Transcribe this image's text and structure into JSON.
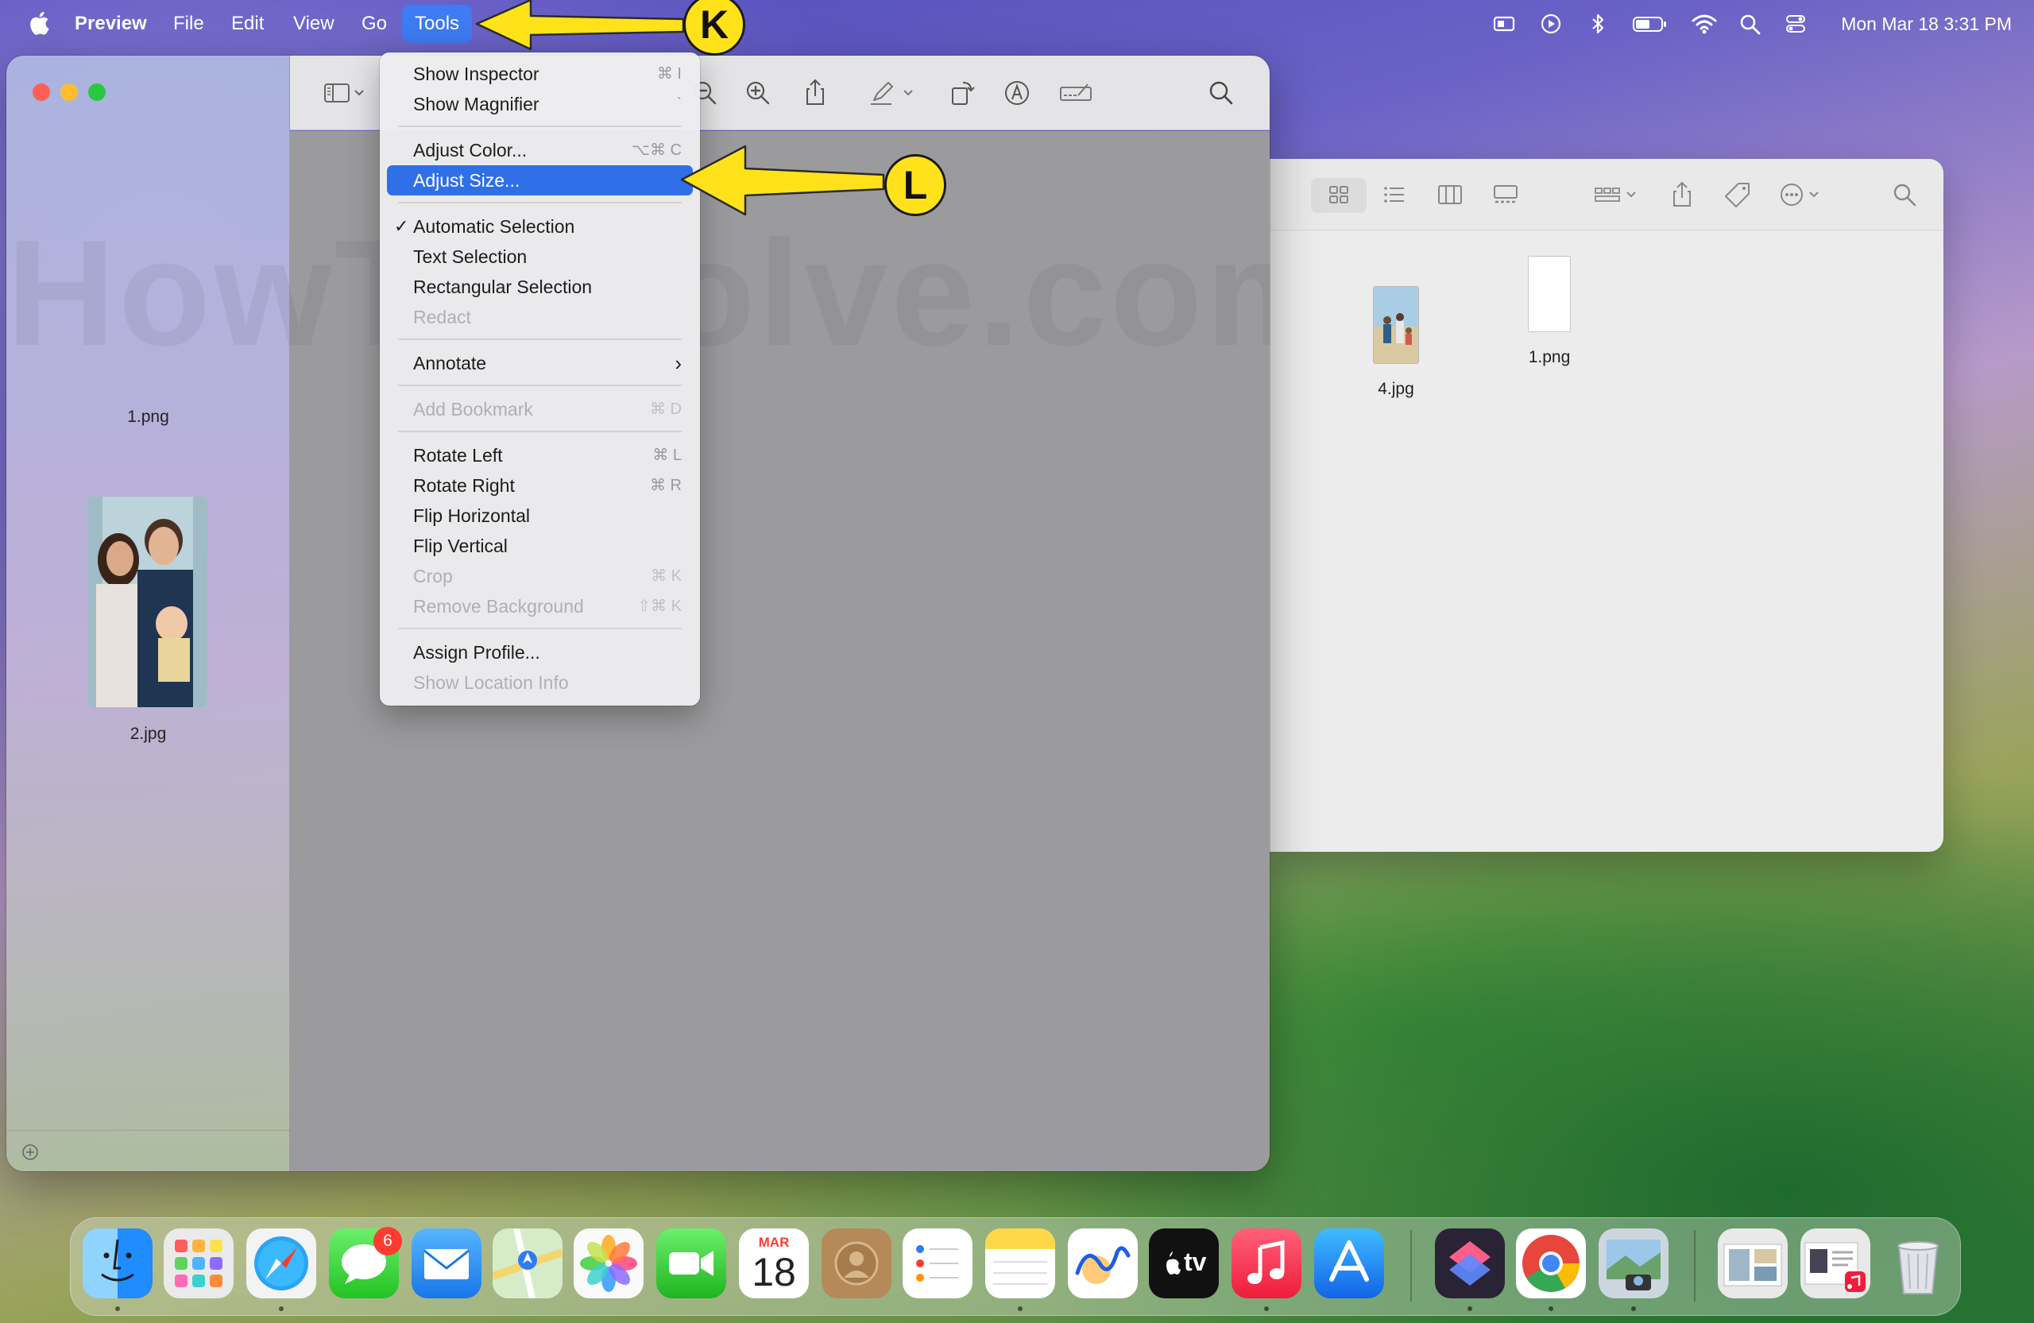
{
  "menubar": {
    "app_name": "Preview",
    "items": [
      "File",
      "Edit",
      "View",
      "Go",
      "Tools"
    ],
    "clock": "Mon Mar 18  3:31 PM",
    "accent_color": "#3f7bf2"
  },
  "sidebar": {
    "thumbnails": [
      {
        "label": "1.png"
      },
      {
        "label": "2.jpg"
      }
    ]
  },
  "tools_menu": {
    "items": [
      {
        "label": "Show Inspector",
        "shortcut": "⌘ I"
      },
      {
        "label": "Show Magnifier",
        "shortcut": "`"
      },
      {
        "label": "Adjust Color...",
        "shortcut": "⌥⌘ C"
      },
      {
        "label": "Adjust Size...",
        "shortcut": "",
        "state": "highlighted"
      },
      {
        "label": "Automatic Selection",
        "shortcut": "",
        "checked": true
      },
      {
        "label": "Text Selection",
        "shortcut": ""
      },
      {
        "label": "Rectangular Selection",
        "shortcut": ""
      },
      {
        "label": "Redact",
        "shortcut": "",
        "disabled": true
      },
      {
        "label": "Annotate",
        "shortcut": "",
        "submenu": true
      },
      {
        "label": "Add Bookmark",
        "shortcut": "⌘ D",
        "disabled": true
      },
      {
        "label": "Rotate Left",
        "shortcut": "⌘ L"
      },
      {
        "label": "Rotate Right",
        "shortcut": "⌘ R"
      },
      {
        "label": "Flip Horizontal",
        "shortcut": ""
      },
      {
        "label": "Flip Vertical",
        "shortcut": ""
      },
      {
        "label": "Crop",
        "shortcut": "⌘ K",
        "disabled": true
      },
      {
        "label": "Remove Background",
        "shortcut": "⇧⌘ K",
        "disabled": true
      },
      {
        "label": "Assign Profile...",
        "shortcut": ""
      },
      {
        "label": "Show Location Info",
        "shortcut": "",
        "disabled": true
      }
    ],
    "highlight_color": "#2f6fe8"
  },
  "finder": {
    "files": [
      {
        "label": "4.jpg"
      },
      {
        "label": "1.png"
      }
    ]
  },
  "annotations": {
    "callout_k": "K",
    "callout_l": "L",
    "arrow_color": "#ffe21a"
  },
  "watermark": "HowToiSolve.com",
  "dock": {
    "apps": [
      "Finder",
      "Launchpad",
      "Safari",
      "Messages",
      "Mail",
      "Maps",
      "Photos",
      "FaceTime",
      "Calendar",
      "Contacts",
      "Reminders",
      "Notes",
      "Freeform",
      "Apple TV",
      "Music",
      "App Store",
      "Shortcuts",
      "Chrome",
      "Preview",
      "Downloads",
      "Recent Documents",
      "Trash"
    ],
    "calendar_month": "MAR",
    "calendar_day": "18",
    "messages_badge": "6",
    "appletv_label": "tv"
  }
}
